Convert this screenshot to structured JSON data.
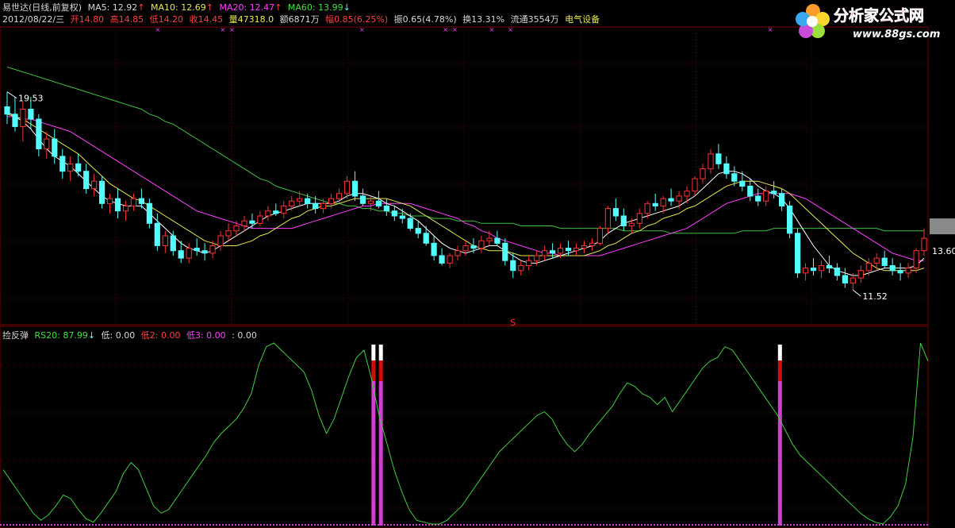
{
  "header": {
    "stock": "易世达(日线,前复权)",
    "ma5": "MA5: 12.92",
    "ma10": "MA10: 12.69",
    "ma20": "MA20: 12.47",
    "ma60": "MA60: 13.99",
    "up_arrow": "↑",
    "down_arrow": "↓"
  },
  "quote": {
    "date": "2012/08/22/三",
    "open": "开14.80",
    "high": "高14.85",
    "low": "低14.20",
    "close": "收14.45",
    "volume": "量47318.0",
    "amount": "额6871万",
    "change": "幅0.85(6.25%)",
    "amplitude": "振0.65(4.78%)",
    "turnover": "换13.31%",
    "float": "流通3554万",
    "sector": "电气设备"
  },
  "indicator": {
    "name": "捡反弹",
    "rs20": "RS20: 87.99",
    "arrow": "↓",
    "di": "低: 0.00",
    "di2": "低2: 0.00",
    "di3": "低3: 0.00",
    "colon": ": 0.00"
  },
  "logo": {
    "title": "分析家公式网",
    "url": "www.88gs.com"
  },
  "colors": {
    "up": "#ff3232",
    "down": "#54ffff",
    "ma5": "#ffffff",
    "ma10": "#e8e850",
    "ma20": "#ff40ff",
    "ma60": "#40c040",
    "rs20": "#40d040",
    "signal": "#d040d0"
  },
  "chart_data": {
    "type": "candlestick",
    "price_labels": {
      "high": "19.53",
      "low": "11.52",
      "last": "13.60"
    },
    "marker": "S",
    "candles": [
      [
        18.9,
        19.5,
        18.2,
        18.6
      ],
      [
        18.6,
        19.3,
        17.9,
        18.1
      ],
      [
        18.1,
        19.1,
        17.5,
        18.8
      ],
      [
        18.8,
        19.3,
        18.0,
        18.4
      ],
      [
        18.4,
        18.6,
        16.9,
        17.2
      ],
      [
        17.2,
        17.9,
        16.8,
        17.6
      ],
      [
        17.6,
        18.0,
        16.6,
        16.9
      ],
      [
        16.9,
        17.2,
        16.0,
        16.3
      ],
      [
        16.3,
        16.9,
        15.9,
        16.6
      ],
      [
        16.6,
        17.0,
        16.1,
        16.3
      ],
      [
        16.3,
        16.6,
        15.4,
        15.6
      ],
      [
        15.6,
        16.2,
        15.3,
        15.9
      ],
      [
        15.9,
        16.1,
        14.8,
        15.0
      ],
      [
        15.0,
        15.4,
        14.6,
        15.2
      ],
      [
        15.2,
        15.6,
        14.4,
        14.7
      ],
      [
        14.7,
        15.1,
        14.3,
        14.9
      ],
      [
        14.9,
        15.4,
        14.7,
        15.2
      ],
      [
        15.2,
        15.6,
        14.8,
        15.0
      ],
      [
        15.0,
        15.2,
        14.0,
        14.2
      ],
      [
        14.2,
        14.6,
        13.1,
        13.3
      ],
      [
        13.3,
        13.9,
        13.0,
        13.7
      ],
      [
        13.7,
        13.9,
        12.9,
        13.1
      ],
      [
        13.1,
        13.5,
        12.6,
        12.8
      ],
      [
        12.8,
        13.4,
        12.6,
        13.2
      ],
      [
        13.2,
        13.6,
        12.9,
        13.1
      ],
      [
        13.1,
        13.4,
        12.7,
        13.0
      ],
      [
        13.0,
        13.5,
        12.8,
        13.3
      ],
      [
        13.3,
        13.9,
        13.1,
        13.7
      ],
      [
        13.7,
        14.2,
        13.5,
        13.9
      ],
      [
        13.9,
        14.3,
        13.7,
        14.1
      ],
      [
        14.1,
        14.5,
        13.9,
        14.3
      ],
      [
        14.3,
        14.6,
        14.0,
        14.2
      ],
      [
        14.2,
        14.7,
        14.1,
        14.5
      ],
      [
        14.5,
        14.9,
        14.3,
        14.7
      ],
      [
        14.7,
        15.0,
        14.5,
        14.6
      ],
      [
        14.6,
        15.1,
        14.4,
        14.9
      ],
      [
        14.9,
        15.3,
        14.7,
        15.1
      ],
      [
        15.1,
        15.5,
        14.9,
        15.2
      ],
      [
        15.2,
        15.4,
        14.8,
        15.0
      ],
      [
        15.0,
        15.3,
        14.6,
        14.8
      ],
      [
        14.8,
        15.2,
        14.6,
        15.0
      ],
      [
        15.0,
        15.4,
        14.8,
        15.2
      ],
      [
        15.2,
        15.6,
        15.0,
        15.4
      ],
      [
        15.4,
        16.1,
        15.2,
        15.9
      ],
      [
        15.9,
        16.3,
        15.1,
        15.3
      ],
      [
        15.3,
        15.6,
        14.9,
        15.0
      ],
      [
        15.0,
        15.3,
        14.7,
        15.1
      ],
      [
        15.1,
        15.5,
        14.8,
        14.9
      ],
      [
        14.9,
        15.2,
        14.5,
        14.7
      ],
      [
        14.7,
        14.9,
        14.3,
        14.5
      ],
      [
        14.5,
        14.8,
        14.2,
        14.4
      ],
      [
        14.4,
        14.6,
        13.9,
        14.0
      ],
      [
        14.0,
        14.3,
        13.6,
        13.8
      ],
      [
        13.8,
        14.1,
        13.3,
        13.4
      ],
      [
        13.4,
        13.7,
        12.7,
        12.9
      ],
      [
        12.9,
        13.2,
        12.5,
        12.6
      ],
      [
        12.6,
        13.0,
        12.4,
        12.9
      ],
      [
        12.9,
        13.3,
        12.7,
        13.1
      ],
      [
        13.1,
        13.5,
        12.9,
        13.3
      ],
      [
        13.3,
        13.6,
        13.0,
        13.2
      ],
      [
        13.2,
        13.7,
        13.0,
        13.5
      ],
      [
        13.5,
        13.9,
        13.3,
        13.6
      ],
      [
        13.6,
        13.9,
        13.3,
        13.4
      ],
      [
        13.4,
        13.6,
        12.5,
        12.7
      ],
      [
        12.7,
        13.0,
        12.0,
        12.3
      ],
      [
        12.3,
        12.7,
        12.1,
        12.5
      ],
      [
        12.5,
        12.9,
        12.3,
        12.7
      ],
      [
        12.7,
        13.1,
        12.5,
        12.9
      ],
      [
        12.9,
        13.3,
        12.7,
        13.1
      ],
      [
        13.1,
        13.4,
        12.8,
        13.0
      ],
      [
        13.0,
        13.4,
        12.8,
        13.2
      ],
      [
        13.2,
        13.5,
        12.9,
        13.1
      ],
      [
        13.1,
        13.4,
        12.9,
        13.2
      ],
      [
        13.2,
        13.5,
        13.0,
        13.3
      ],
      [
        13.3,
        13.6,
        13.1,
        13.4
      ],
      [
        13.4,
        14.1,
        13.3,
        14.0
      ],
      [
        14.0,
        14.9,
        13.8,
        14.8
      ],
      [
        14.8,
        15.2,
        14.3,
        14.5
      ],
      [
        14.5,
        14.8,
        13.9,
        14.1
      ],
      [
        14.1,
        14.4,
        13.8,
        14.2
      ],
      [
        14.2,
        14.8,
        14.0,
        14.6
      ],
      [
        14.6,
        15.1,
        14.4,
        15.0
      ],
      [
        15.0,
        15.4,
        14.7,
        14.9
      ],
      [
        14.9,
        15.3,
        14.6,
        15.2
      ],
      [
        15.2,
        15.6,
        14.9,
        15.1
      ],
      [
        15.1,
        15.5,
        14.8,
        15.3
      ],
      [
        15.3,
        15.7,
        15.0,
        15.5
      ],
      [
        15.5,
        16.1,
        15.3,
        16.0
      ],
      [
        16.0,
        16.6,
        15.8,
        16.4
      ],
      [
        16.4,
        17.2,
        16.2,
        17.0
      ],
      [
        17.0,
        17.4,
        16.4,
        16.6
      ],
      [
        16.6,
        16.9,
        16.0,
        16.2
      ],
      [
        16.2,
        16.5,
        15.7,
        15.9
      ],
      [
        15.9,
        16.3,
        15.5,
        15.7
      ],
      [
        15.7,
        16.0,
        15.1,
        15.3
      ],
      [
        15.3,
        15.6,
        14.9,
        15.1
      ],
      [
        15.1,
        15.7,
        14.9,
        15.5
      ],
      [
        15.5,
        15.9,
        15.2,
        15.4
      ],
      [
        15.4,
        15.6,
        14.7,
        14.9
      ],
      [
        14.9,
        15.1,
        13.6,
        13.8
      ],
      [
        13.8,
        14.0,
        12.0,
        12.2
      ],
      [
        12.2,
        12.6,
        11.9,
        12.4
      ],
      [
        12.4,
        12.8,
        12.1,
        12.3
      ],
      [
        12.3,
        12.7,
        12.0,
        12.5
      ],
      [
        12.5,
        12.9,
        12.2,
        12.4
      ],
      [
        12.4,
        12.6,
        11.9,
        12.1
      ],
      [
        12.1,
        12.4,
        11.6,
        11.8
      ],
      [
        11.8,
        12.2,
        11.52,
        12.0
      ],
      [
        12.0,
        12.5,
        11.8,
        12.3
      ],
      [
        12.3,
        12.8,
        12.1,
        12.6
      ],
      [
        12.6,
        13.0,
        12.3,
        12.8
      ],
      [
        12.8,
        13.1,
        12.4,
        12.5
      ],
      [
        12.5,
        12.8,
        12.1,
        12.3
      ],
      [
        12.3,
        12.6,
        11.9,
        12.2
      ],
      [
        12.2,
        12.6,
        12.0,
        12.4
      ],
      [
        12.4,
        13.2,
        12.2,
        13.1
      ],
      [
        13.1,
        14.0,
        12.9,
        13.6
      ]
    ],
    "ma5": [
      18.7,
      18.5,
      18.3,
      18.0,
      17.6,
      17.2,
      16.9,
      16.7,
      16.5,
      16.2,
      15.9,
      15.6,
      15.3,
      15.1,
      15.0,
      14.9,
      14.9,
      14.9,
      14.6,
      14.3,
      14.0,
      13.7,
      13.4,
      13.2,
      13.1,
      13.0,
      13.1,
      13.3,
      13.5,
      13.7,
      13.9,
      14.1,
      14.3,
      14.5,
      14.6,
      14.7,
      14.8,
      14.9,
      15.0,
      15.0,
      15.0,
      15.0,
      15.1,
      15.3,
      15.4,
      15.4,
      15.3,
      15.2,
      15.0,
      14.9,
      14.7,
      14.5,
      14.3,
      14.0,
      13.7,
      13.4,
      13.2,
      13.1,
      13.0,
      13.1,
      13.2,
      13.3,
      13.3,
      13.1,
      12.9,
      12.7,
      12.6,
      12.6,
      12.7,
      12.8,
      12.9,
      13.0,
      13.1,
      13.2,
      13.3,
      13.5,
      13.8,
      14.0,
      14.2,
      14.3,
      14.4,
      14.5,
      14.6,
      14.7,
      14.8,
      14.9,
      15.1,
      15.3,
      15.6,
      15.9,
      16.2,
      16.3,
      16.3,
      16.2,
      16.0,
      15.7,
      15.5,
      15.4,
      15.2,
      14.8,
      14.3,
      13.8,
      13.3,
      12.9,
      12.5,
      12.3,
      12.2,
      12.1,
      12.1,
      12.2,
      12.3,
      12.4,
      12.4,
      12.4,
      12.4,
      12.5,
      12.8
    ],
    "ma10": [
      18.6,
      18.5,
      18.4,
      18.2,
      18.0,
      17.8,
      17.6,
      17.4,
      17.2,
      17.0,
      16.7,
      16.4,
      16.1,
      15.8,
      15.6,
      15.4,
      15.2,
      15.1,
      14.9,
      14.7,
      14.5,
      14.3,
      14.1,
      13.9,
      13.7,
      13.5,
      13.4,
      13.3,
      13.3,
      13.3,
      13.4,
      13.5,
      13.7,
      13.8,
      14.0,
      14.2,
      14.4,
      14.5,
      14.7,
      14.8,
      14.9,
      14.9,
      15.0,
      15.1,
      15.2,
      15.2,
      15.2,
      15.2,
      15.2,
      15.1,
      15.0,
      14.9,
      14.7,
      14.5,
      14.3,
      14.1,
      13.9,
      13.7,
      13.5,
      13.3,
      13.2,
      13.1,
      13.1,
      13.1,
      13.0,
      12.9,
      12.9,
      12.9,
      12.9,
      12.9,
      12.9,
      12.9,
      12.9,
      12.9,
      13.0,
      13.1,
      13.3,
      13.4,
      13.6,
      13.8,
      13.9,
      14.1,
      14.2,
      14.4,
      14.5,
      14.6,
      14.8,
      14.9,
      15.1,
      15.3,
      15.5,
      15.7,
      15.8,
      15.9,
      15.9,
      15.9,
      15.8,
      15.7,
      15.6,
      15.4,
      15.1,
      14.8,
      14.5,
      14.2,
      13.9,
      13.6,
      13.3,
      13.0,
      12.8,
      12.6,
      12.4,
      12.3,
      12.3,
      12.3,
      12.3,
      12.3,
      12.4
    ],
    "ma20": [
      18.5,
      18.5,
      18.4,
      18.4,
      18.3,
      18.2,
      18.1,
      18.0,
      17.9,
      17.7,
      17.5,
      17.3,
      17.1,
      16.9,
      16.7,
      16.5,
      16.3,
      16.1,
      15.9,
      15.7,
      15.5,
      15.3,
      15.1,
      14.9,
      14.7,
      14.6,
      14.5,
      14.4,
      14.3,
      14.2,
      14.1,
      14.0,
      14.0,
      14.0,
      14.0,
      14.0,
      14.0,
      14.1,
      14.2,
      14.3,
      14.4,
      14.5,
      14.6,
      14.7,
      14.8,
      14.9,
      14.9,
      15.0,
      15.0,
      15.0,
      15.0,
      15.0,
      14.9,
      14.8,
      14.7,
      14.6,
      14.5,
      14.4,
      14.2,
      14.1,
      13.9,
      13.8,
      13.6,
      13.5,
      13.4,
      13.3,
      13.2,
      13.1,
      13.0,
      13.0,
      12.9,
      12.9,
      12.9,
      12.9,
      12.9,
      12.9,
      13.0,
      13.1,
      13.2,
      13.3,
      13.4,
      13.5,
      13.6,
      13.7,
      13.8,
      13.9,
      14.0,
      14.2,
      14.4,
      14.6,
      14.8,
      15.0,
      15.1,
      15.2,
      15.3,
      15.4,
      15.4,
      15.4,
      15.4,
      15.4,
      15.3,
      15.2,
      15.0,
      14.8,
      14.6,
      14.4,
      14.2,
      14.0,
      13.8,
      13.6,
      13.4,
      13.2,
      13.0,
      12.9,
      12.8,
      12.7,
      12.7
    ],
    "ma60": [
      20.5,
      20.4,
      20.3,
      20.2,
      20.1,
      20.0,
      19.9,
      19.8,
      19.7,
      19.6,
      19.5,
      19.4,
      19.3,
      19.2,
      19.1,
      19.0,
      18.9,
      18.8,
      18.6,
      18.5,
      18.3,
      18.2,
      18.0,
      17.8,
      17.6,
      17.4,
      17.2,
      17.0,
      16.8,
      16.6,
      16.4,
      16.2,
      16.0,
      15.9,
      15.7,
      15.6,
      15.5,
      15.4,
      15.3,
      15.2,
      15.1,
      15.0,
      15.0,
      14.9,
      14.9,
      14.8,
      14.8,
      14.7,
      14.7,
      14.6,
      14.6,
      14.5,
      14.5,
      14.5,
      14.4,
      14.4,
      14.4,
      14.3,
      14.3,
      14.3,
      14.2,
      14.2,
      14.2,
      14.2,
      14.2,
      14.1,
      14.1,
      14.1,
      14.1,
      14.1,
      14.0,
      14.0,
      14.0,
      14.0,
      14.0,
      14.0,
      14.0,
      14.0,
      13.9,
      13.9,
      13.9,
      13.9,
      13.9,
      13.9,
      13.8,
      13.8,
      13.8,
      13.8,
      13.8,
      13.8,
      13.8,
      13.8,
      13.8,
      13.9,
      13.9,
      13.9,
      13.9,
      14.0,
      14.0,
      14.0,
      14.0,
      14.0,
      14.0,
      14.0,
      14.0,
      14.0,
      14.0,
      14.0,
      14.0,
      14.0,
      14.0,
      13.9,
      13.9,
      13.9,
      13.9,
      13.9,
      13.9
    ],
    "rs20": [
      30,
      24,
      18,
      12,
      6,
      2,
      5,
      10,
      16,
      14,
      8,
      3,
      1,
      6,
      12,
      18,
      28,
      34,
      30,
      20,
      10,
      6,
      8,
      14,
      20,
      26,
      32,
      38,
      45,
      50,
      54,
      58,
      64,
      72,
      88,
      98,
      100,
      96,
      92,
      88,
      84,
      74,
      60,
      50,
      58,
      70,
      82,
      92,
      96,
      80,
      60,
      45,
      30,
      18,
      8,
      2,
      1,
      0,
      0,
      2,
      6,
      10,
      16,
      22,
      28,
      34,
      40,
      44,
      48,
      52,
      56,
      60,
      62,
      58,
      50,
      44,
      40,
      44,
      50,
      55,
      60,
      65,
      72,
      78,
      76,
      72,
      70,
      66,
      70,
      62,
      68,
      74,
      80,
      86,
      90,
      92,
      98,
      96,
      90,
      84,
      78,
      72,
      66,
      60,
      52,
      44,
      38,
      34,
      30,
      26,
      22,
      18,
      14,
      10,
      6,
      3,
      1,
      0,
      4,
      10,
      22,
      48,
      100,
      90
    ]
  }
}
